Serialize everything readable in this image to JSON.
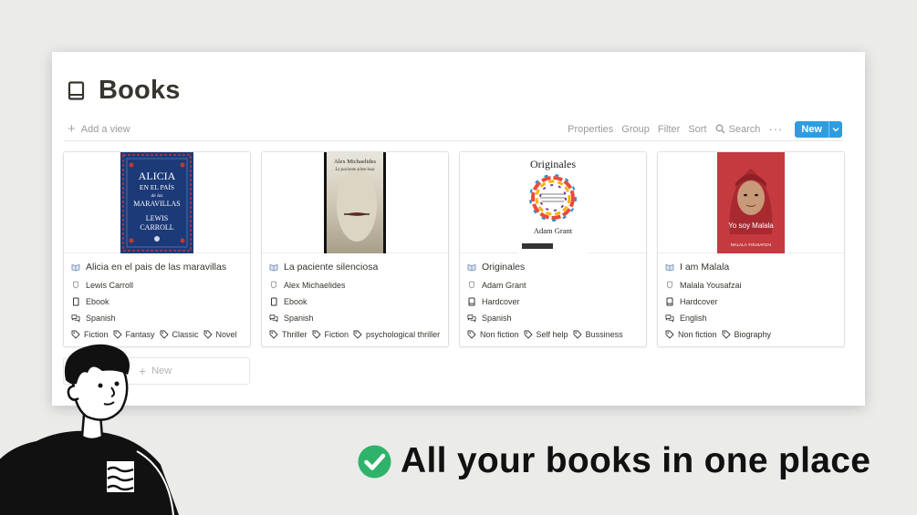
{
  "page": {
    "title": "Books",
    "icon": "book-icon"
  },
  "toolbar": {
    "add_view_label": "Add a view",
    "properties_label": "Properties",
    "group_label": "Group",
    "filter_label": "Filter",
    "sort_label": "Sort",
    "search_label": "Search",
    "more_label": "···",
    "new_label": "New",
    "accent_color": "#2e9de0"
  },
  "books": [
    {
      "title": "Alicia en el pais de las maravillas",
      "author": "Lewis Carroll",
      "format": "Ebook",
      "language": "Spanish",
      "tags": [
        "Fiction",
        "Fantasy",
        "Classic",
        "Novel"
      ],
      "cover": {
        "lines": [
          "ALICIA",
          "EN EL PAÍS",
          "de las",
          "MARAVILLAS",
          "LEWIS",
          "CARROLL"
        ],
        "bg_color": "#1c3a78"
      }
    },
    {
      "title": "La paciente silenciosa",
      "author": "Alex Michaelides",
      "format": "Ebook",
      "language": "Spanish",
      "tags": [
        "Thriller",
        "Fiction",
        "psychological thriller"
      ],
      "cover": {
        "lines": [
          "Alex Michaelides",
          "La paciente silenciosa"
        ],
        "bg_color": "#c9c6b8"
      }
    },
    {
      "title": "Originales",
      "author": "Adam Grant",
      "format": "Hardcover",
      "language": "Spanish",
      "tags": [
        "Non fiction",
        "Self help",
        "Bussiness"
      ],
      "cover": {
        "lines": [
          "Originales",
          "Adam Grant"
        ],
        "bg_color": "#ffffff"
      }
    },
    {
      "title": "I am Malala",
      "author": "Malala Yousafzai",
      "format": "Hardcover",
      "language": "English",
      "tags": [
        "Non fiction",
        "Biography"
      ],
      "cover": {
        "lines": [
          "Yo soy Malala",
          "MALALA YOUSAFZAI"
        ],
        "bg_color": "#c43a3f"
      }
    }
  ],
  "new_card_label": "New",
  "tagline": {
    "text": "All your books in one place",
    "check_color": "#2fb36b"
  }
}
